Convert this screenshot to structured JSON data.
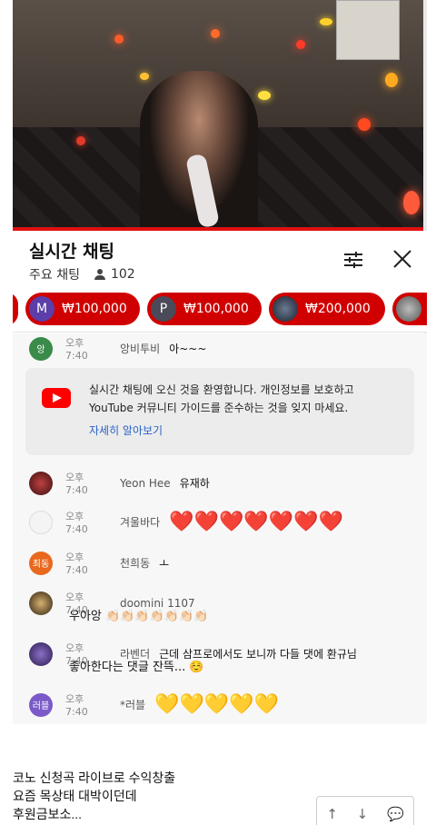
{
  "chat": {
    "title": "실시간 채팅",
    "filter_label": "주요 채팅",
    "viewer_count": "102"
  },
  "ticker": [
    {
      "initial": "",
      "amount": "",
      "color": "#d00000"
    },
    {
      "initial": "M",
      "amount": "₩100,000",
      "color": "#5b3ea8"
    },
    {
      "initial": "P",
      "amount": "₩100,000",
      "color": "#4a4a58"
    },
    {
      "initial": "",
      "amount": "₩200,000",
      "color": "#2a3850"
    },
    {
      "initial": "",
      "amount": "",
      "color": "#666"
    }
  ],
  "top_message": {
    "avatar": "앙",
    "time": "오후 7:40",
    "name": "앙비투비",
    "text": "아~~~"
  },
  "notice": {
    "text": "실시간 채팅에 오신 것을 환영합니다. 개인정보를 보호하고 YouTube 커뮤니티 가이드를 준수하는 것을 잊지 마세요.",
    "link": "자세히 알아보기"
  },
  "messages": [
    {
      "time": "오후 7:40",
      "name": "Yeon Hee",
      "text": "유재하"
    },
    {
      "time": "오후 7:40",
      "name": "겨울바다",
      "text": "❤️❤️❤️❤️❤️❤️❤️"
    },
    {
      "avatar": "최동",
      "time": "오후 7:40",
      "name": "천희동",
      "text": "ㅗ"
    },
    {
      "time": "오후 7:40",
      "name": "doomini 1107",
      "text": "",
      "cont": "우아앙 👏🏻👏🏻👏🏻👏🏻👏🏻👏🏻👏🏻"
    },
    {
      "time": "오후 7:40",
      "name": "라벤더",
      "text": "근데 삼프로에서도 보니까 다들 댓에 환규님",
      "cont": "좋아한다는 댓글 잔뜩... ☺️"
    },
    {
      "avatar": "러블",
      "time": "오후 7:40",
      "name": "*러블",
      "text": "💛💛💛💛💛"
    }
  ],
  "article": {
    "line1": "코노 신청곡 라이브로 수익창출",
    "line2": "요즘 목상태 대박이던데",
    "line3": "후원금보소..."
  },
  "actions": {
    "up": "↑",
    "down": "↓",
    "comment": "💬"
  },
  "colors": {
    "accent": "#e01010",
    "superchat": "#d00000",
    "link": "#2a62c8"
  }
}
